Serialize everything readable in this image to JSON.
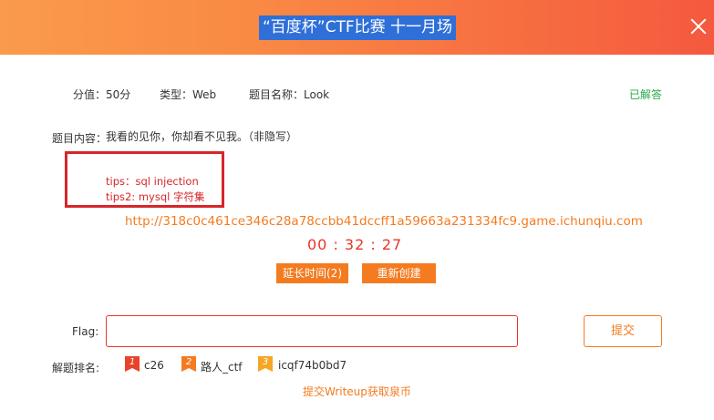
{
  "header": {
    "title": "“百度杯”CTF比赛 十一月场"
  },
  "meta": {
    "score": "分值：50分",
    "type": "类型：Web",
    "name": "题目名称：Look",
    "status": "已解答"
  },
  "content": {
    "label": "题目内容：",
    "text": "我看的见你，你却看不见我。（非隐写）",
    "tip1": "tips：sql injection",
    "tip2": "tips2: mysql 字符集"
  },
  "challenge": {
    "url": "http://318c0c461ce346c28a78ccbb41dccff1a59663a231334fc9.game.ichunqiu.com",
    "timer": "00 : 32 : 27",
    "extend_label": "延长时间(2)",
    "recreate_label": "重新创建"
  },
  "flag": {
    "label": "Flag:",
    "value": "",
    "placeholder": "",
    "submit_label": "提交"
  },
  "ranking": {
    "label": "解题排名:",
    "entries": [
      {
        "rank": "1",
        "name": "c26",
        "color": "#e8442a"
      },
      {
        "rank": "2",
        "name": "路人_ctf",
        "color": "#f47b20"
      },
      {
        "rank": "3",
        "name": "icqf74b0bd7",
        "color": "#f5a623"
      }
    ]
  },
  "footer": {
    "writeup_link": "提交Writeup获取泉币"
  },
  "colors": {
    "accent": "#f47b20",
    "title_highlight": "#2f6fd8",
    "solved": "#2aa84a",
    "tip": "#d6262a"
  }
}
